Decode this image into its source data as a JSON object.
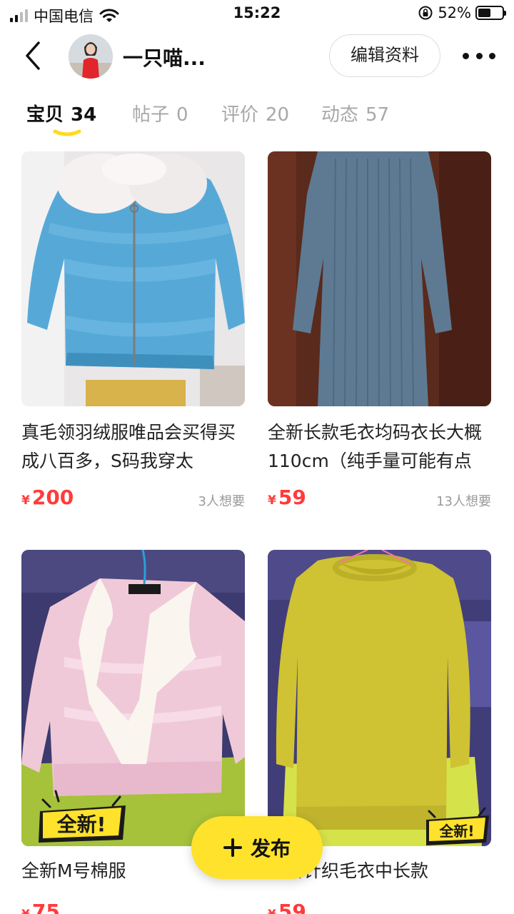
{
  "status_bar": {
    "carrier": "中国电信",
    "time": "15:22",
    "battery": "52%",
    "battery_level": 0.52,
    "icons": [
      "signal-icon",
      "wifi-icon",
      "rotation-lock-icon",
      "battery-icon"
    ]
  },
  "header": {
    "nickname": "一只喵...",
    "edit_profile_label": "编辑资料",
    "icons": [
      "back-icon",
      "avatar",
      "more-icon"
    ]
  },
  "tabs": [
    {
      "label": "宝贝",
      "count": "34",
      "active": true
    },
    {
      "label": "帖子",
      "count": "0",
      "active": false
    },
    {
      "label": "评价",
      "count": "20",
      "active": false
    },
    {
      "label": "动态",
      "count": "57",
      "active": false
    }
  ],
  "products": [
    {
      "title": "真毛领羽绒服唯品会买得买成八百多，S码我穿太",
      "currency": "¥",
      "price": "200",
      "wants": "3人想要",
      "image": "blue-down-jacket"
    },
    {
      "title": "全新长款毛衣均码衣长大概110cm（纯手量可能有点",
      "currency": "¥",
      "price": "59",
      "wants": "13人想要",
      "image": "blue-knit-sweater-dress"
    },
    {
      "title": "全新M号棉服",
      "currency": "¥",
      "price": "75",
      "wants": "",
      "image": "pink-cotton-jacket",
      "badge": "全新!"
    },
    {
      "title": "全新针织毛衣中长款",
      "currency": "¥",
      "price": "59",
      "wants": "",
      "image": "yellow-knit-sweater",
      "badge": "全新!"
    }
  ],
  "fab": {
    "label": "发布"
  },
  "colors": {
    "accent": "#ffe22b",
    "price": "#ff3b3b",
    "muted": "#a8a8a8"
  }
}
